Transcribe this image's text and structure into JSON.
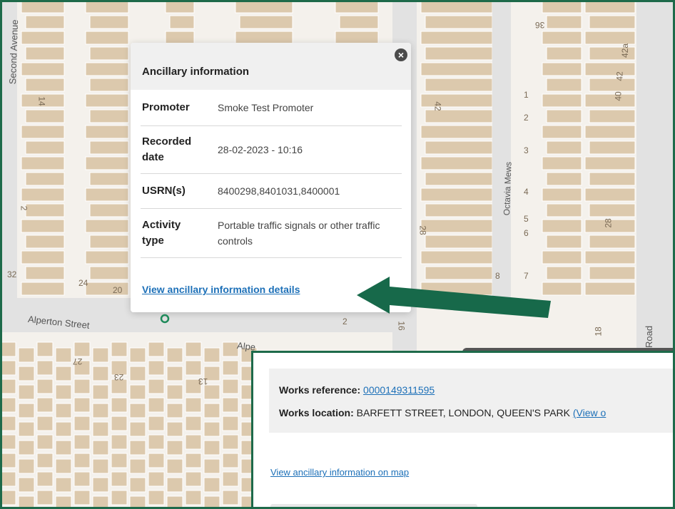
{
  "map": {
    "streets": {
      "second_avenue": "Second Avenue",
      "alperton_street": "Alperton Street",
      "alperton_street_2": "Alpe",
      "octavia_mews": "Octavia Mews",
      "road": "Road"
    },
    "house_numbers": [
      "14",
      "2",
      "32",
      "24",
      "20",
      "42",
      "28",
      "16",
      "8",
      "40",
      "42",
      "42a",
      "28",
      "18",
      "27",
      "23",
      "13",
      "1",
      "2",
      "3",
      "4",
      "5",
      "6",
      "7",
      "2",
      "36"
    ]
  },
  "popup": {
    "title": "Ancillary information",
    "close_label": "×",
    "rows": [
      {
        "label": "Promoter",
        "value": "Smoke Test Promoter"
      },
      {
        "label": "Recorded date",
        "value": "28-02-2023 - 10:16"
      },
      {
        "label": "USRN(s)",
        "value": "8400298,8401031,8400001"
      },
      {
        "label": "Activity type",
        "value": "Portable traffic signals or other traffic controls"
      }
    ],
    "link": "View ancillary information details"
  },
  "details_panel": {
    "works_reference_label": "Works reference:",
    "works_reference_value": "0000149311595",
    "works_location_label": "Works location:",
    "works_location_value": "BARFETT STREET, LONDON, QUEEN'S PARK",
    "works_location_link": "(View o",
    "map_link": "View ancillary information on map"
  },
  "colors": {
    "frame": "#1e6a4a",
    "arrow": "#17694a",
    "link": "#1d70b8",
    "building": "#dcc9ad",
    "road": "#e2e2e2"
  }
}
